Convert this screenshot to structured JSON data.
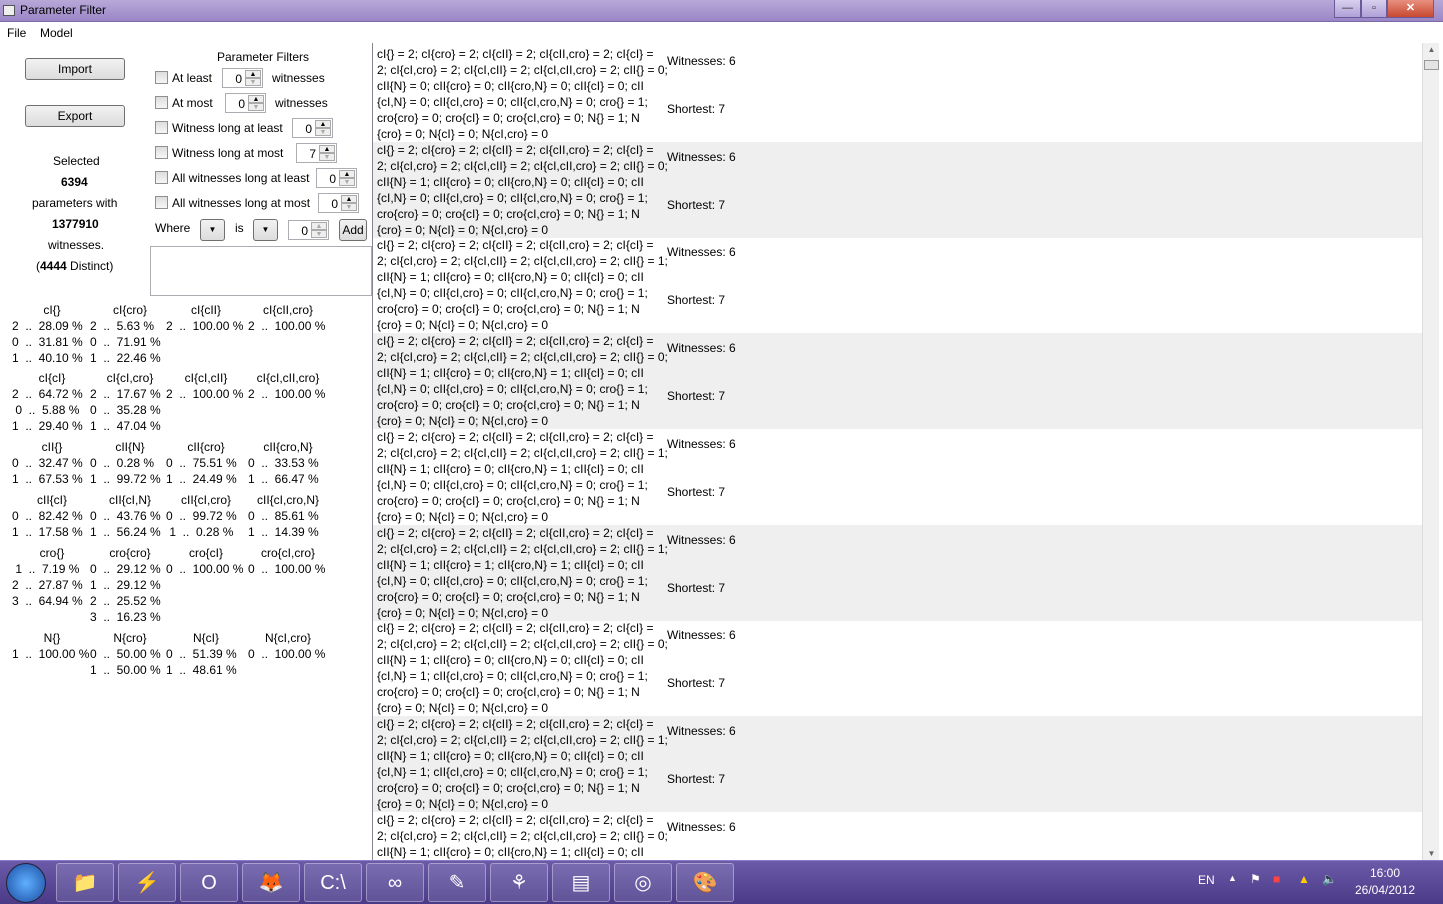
{
  "window": {
    "title": "Parameter Filter",
    "minimize": "—",
    "maximize": "▫",
    "close": "✕"
  },
  "menu": [
    "File",
    "Model"
  ],
  "actions": {
    "import": "Import",
    "export": "Export"
  },
  "summary": {
    "selected_label": "Selected",
    "selected_count": "6394",
    "params_with": "parameters with",
    "witness_count": "1377910",
    "witnesses_label": "witnesses.",
    "distinct_open": "(",
    "distinct_count": "4444",
    "distinct_close": " Distinct)"
  },
  "filters": {
    "title": "Parameter Filters",
    "rows": [
      {
        "label": "At least",
        "value": "0",
        "suffix": "witnesses",
        "checked": false
      },
      {
        "label": "At most",
        "value": "0",
        "suffix": "witnesses",
        "checked": false
      },
      {
        "label": "Witness long at least",
        "value": "0",
        "suffix": "",
        "checked": false
      },
      {
        "label": "Witness long at most",
        "value": "7",
        "suffix": "",
        "checked": false
      },
      {
        "label": "All witnesses long at least",
        "value": "0",
        "suffix": "",
        "checked": false
      },
      {
        "label": "All witnesses long at most",
        "value": "0",
        "suffix": "",
        "checked": false
      }
    ],
    "where_label": "Where",
    "is_label": "is",
    "where_value": "0",
    "add": "Add"
  },
  "stats": [
    [
      {
        "h": "cI{}",
        "r": [
          "2  ..  28.09 %",
          "0  ..  31.81 %",
          "1  ..  40.10 %"
        ]
      },
      {
        "h": "cI{cro}",
        "r": [
          "2  ..  5.63 %",
          "0  ..  71.91 %",
          "1  ..  22.46 %"
        ]
      },
      {
        "h": "cI{cII}",
        "r": [
          "2  ..  100.00 %"
        ]
      },
      {
        "h": "cI{cII,cro}",
        "r": [
          "2  ..  100.00 %"
        ]
      }
    ],
    [
      {
        "h": "cI{cI}",
        "r": [
          "2  ..  64.72 %",
          " 0  ..  5.88 %",
          "1  ..  29.40 %"
        ]
      },
      {
        "h": "cI{cI,cro}",
        "r": [
          "2  ..  17.67 %",
          "0  ..  35.28 %",
          "1  ..  47.04 %"
        ]
      },
      {
        "h": "cI{cI,cII}",
        "r": [
          "2  ..  100.00 %"
        ]
      },
      {
        "h": "cI{cI,cII,cro}",
        "r": [
          "2  ..  100.00 %"
        ]
      }
    ],
    [
      {
        "h": "cII{}",
        "r": [
          "0  ..  32.47 %",
          "1  ..  67.53 %"
        ]
      },
      {
        "h": "cII{N}",
        "r": [
          "0  ..  0.28 %",
          "1  ..  99.72 %"
        ]
      },
      {
        "h": "cII{cro}",
        "r": [
          "0  ..  75.51 %",
          "1  ..  24.49 %"
        ]
      },
      {
        "h": "cII{cro,N}",
        "r": [
          "0  ..  33.53 %",
          "1  ..  66.47 %"
        ]
      }
    ],
    [
      {
        "h": "cII{cI}",
        "r": [
          "0  ..  82.42 %",
          "1  ..  17.58 %"
        ]
      },
      {
        "h": "cII{cI,N}",
        "r": [
          "0  ..  43.76 %",
          "1  ..  56.24 %"
        ]
      },
      {
        "h": "cII{cI,cro}",
        "r": [
          "0  ..  99.72 %",
          " 1  ..  0.28 %"
        ]
      },
      {
        "h": "cII{cI,cro,N}",
        "r": [
          "0  ..  85.61 %",
          "1  ..  14.39 %"
        ]
      }
    ],
    [
      {
        "h": "cro{}",
        "r": [
          " 1  ..  7.19 %",
          "2  ..  27.87 %",
          "3  ..  64.94 %"
        ]
      },
      {
        "h": "cro{cro}",
        "r": [
          "0  ..  29.12 %",
          "1  ..  29.12 %",
          "2  ..  25.52 %",
          "3  ..  16.23 %"
        ]
      },
      {
        "h": "cro{cI}",
        "r": [
          "0  ..  100.00 %"
        ]
      },
      {
        "h": "cro{cI,cro}",
        "r": [
          "0  ..  100.00 %"
        ]
      }
    ],
    [
      {
        "h": "N{}",
        "r": [
          "1  ..  100.00 %"
        ]
      },
      {
        "h": "N{cro}",
        "r": [
          "0  ..  50.00 %",
          "1  ..  50.00 %"
        ]
      },
      {
        "h": "N{cI}",
        "r": [
          "0  ..  51.39 %",
          "1  ..  48.61 %"
        ]
      },
      {
        "h": "N{cI,cro}",
        "r": [
          "0  ..  100.00 %"
        ]
      }
    ]
  ],
  "records": [
    {
      "witnesses": "Witnesses: 6",
      "shortest": "Shortest: 7",
      "lines": [
        "cI{} = 2; cI{cro} = 2; cI{cII} = 2; cI{cII,cro} = 2; cI{cI} =",
        "2; cI{cI,cro} = 2; cI{cI,cII} = 2; cI{cI,cII,cro} = 2; cII{} = 0;",
        "cII{N} = 0; cII{cro} = 0; cII{cro,N} = 0; cII{cI} = 0; cII",
        "{cI,N} = 0; cII{cI,cro} = 0; cII{cI,cro,N} = 0; cro{} = 1;",
        "cro{cro} = 0; cro{cI} = 0; cro{cI,cro} = 0; N{} = 1; N",
        "{cro} = 0; N{cI} = 0; N{cI,cro} = 0"
      ]
    },
    {
      "witnesses": "Witnesses: 6",
      "shortest": "Shortest: 7",
      "lines": [
        "cI{} = 2; cI{cro} = 2; cI{cII} = 2; cI{cII,cro} = 2; cI{cI} =",
        "2; cI{cI,cro} = 2; cI{cI,cII} = 2; cI{cI,cII,cro} = 2; cII{} = 0;",
        "cII{N} = 1; cII{cro} = 0; cII{cro,N} = 0; cII{cI} = 0; cII",
        "{cI,N} = 0; cII{cI,cro} = 0; cII{cI,cro,N} = 0; cro{} = 1;",
        "cro{cro} = 0; cro{cI} = 0; cro{cI,cro} = 0; N{} = 1; N",
        "{cro} = 0; N{cI} = 0; N{cI,cro} = 0"
      ]
    },
    {
      "witnesses": "Witnesses: 6",
      "shortest": "Shortest: 7",
      "lines": [
        "cI{} = 2; cI{cro} = 2; cI{cII} = 2; cI{cII,cro} = 2; cI{cI} =",
        "2; cI{cI,cro} = 2; cI{cI,cII} = 2; cI{cI,cII,cro} = 2; cII{} = 1;",
        "cII{N} = 1; cII{cro} = 0; cII{cro,N} = 0; cII{cI} = 0; cII",
        "{cI,N} = 0; cII{cI,cro} = 0; cII{cI,cro,N} = 0; cro{} = 1;",
        "cro{cro} = 0; cro{cI} = 0; cro{cI,cro} = 0; N{} = 1; N",
        "{cro} = 0; N{cI} = 0; N{cI,cro} = 0"
      ]
    },
    {
      "witnesses": "Witnesses: 6",
      "shortest": "Shortest: 7",
      "lines": [
        "cI{} = 2; cI{cro} = 2; cI{cII} = 2; cI{cII,cro} = 2; cI{cI} =",
        "2; cI{cI,cro} = 2; cI{cI,cII} = 2; cI{cI,cII,cro} = 2; cII{} = 0;",
        "cII{N} = 1; cII{cro} = 0; cII{cro,N} = 1; cII{cI} = 0; cII",
        "{cI,N} = 0; cII{cI,cro} = 0; cII{cI,cro,N} = 0; cro{} = 1;",
        "cro{cro} = 0; cro{cI} = 0; cro{cI,cro} = 0; N{} = 1; N",
        "{cro} = 0; N{cI} = 0; N{cI,cro} = 0"
      ]
    },
    {
      "witnesses": "Witnesses: 6",
      "shortest": "Shortest: 7",
      "lines": [
        "cI{} = 2; cI{cro} = 2; cI{cII} = 2; cI{cII,cro} = 2; cI{cI} =",
        "2; cI{cI,cro} = 2; cI{cI,cII} = 2; cI{cI,cII,cro} = 2; cII{} = 1;",
        "cII{N} = 1; cII{cro} = 0; cII{cro,N} = 1; cII{cI} = 0; cII",
        "{cI,N} = 0; cII{cI,cro} = 0; cII{cI,cro,N} = 0; cro{} = 1;",
        "cro{cro} = 0; cro{cI} = 0; cro{cI,cro} = 0; N{} = 1; N",
        "{cro} = 0; N{cI} = 0; N{cI,cro} = 0"
      ]
    },
    {
      "witnesses": "Witnesses: 6",
      "shortest": "Shortest: 7",
      "lines": [
        "cI{} = 2; cI{cro} = 2; cI{cII} = 2; cI{cII,cro} = 2; cI{cI} =",
        "2; cI{cI,cro} = 2; cI{cI,cII} = 2; cI{cI,cII,cro} = 2; cII{} = 1;",
        "cII{N} = 1; cII{cro} = 1; cII{cro,N} = 1; cII{cI} = 0; cII",
        "{cI,N} = 0; cII{cI,cro} = 0; cII{cI,cro,N} = 0; cro{} = 1;",
        "cro{cro} = 0; cro{cI} = 0; cro{cI,cro} = 0; N{} = 1; N",
        "{cro} = 0; N{cI} = 0; N{cI,cro} = 0"
      ]
    },
    {
      "witnesses": "Witnesses: 6",
      "shortest": "Shortest: 7",
      "lines": [
        "cI{} = 2; cI{cro} = 2; cI{cII} = 2; cI{cII,cro} = 2; cI{cI} =",
        "2; cI{cI,cro} = 2; cI{cI,cII} = 2; cI{cI,cII,cro} = 2; cII{} = 0;",
        "cII{N} = 1; cII{cro} = 0; cII{cro,N} = 0; cII{cI} = 0; cII",
        "{cI,N} = 1; cII{cI,cro} = 0; cII{cI,cro,N} = 0; cro{} = 1;",
        "cro{cro} = 0; cro{cI} = 0; cro{cI,cro} = 0; N{} = 1; N",
        "{cro} = 0; N{cI} = 0; N{cI,cro} = 0"
      ]
    },
    {
      "witnesses": "Witnesses: 6",
      "shortest": "Shortest: 7",
      "lines": [
        "cI{} = 2; cI{cro} = 2; cI{cII} = 2; cI{cII,cro} = 2; cI{cI} =",
        "2; cI{cI,cro} = 2; cI{cI,cII} = 2; cI{cI,cII,cro} = 2; cII{} = 1;",
        "cII{N} = 1; cII{cro} = 0; cII{cro,N} = 0; cII{cI} = 0; cII",
        "{cI,N} = 1; cII{cI,cro} = 0; cII{cI,cro,N} = 0; cro{} = 1;",
        "cro{cro} = 0; cro{cI} = 0; cro{cI,cro} = 0; N{} = 1; N",
        "{cro} = 0; N{cI} = 0; N{cI,cro} = 0"
      ]
    },
    {
      "witnesses": "Witnesses: 6",
      "shortest": "",
      "lines": [
        "cI{} = 2; cI{cro} = 2; cI{cII} = 2; cI{cII,cro} = 2; cI{cI} =",
        "2; cI{cI,cro} = 2; cI{cI,cII} = 2; cI{cI,cII,cro} = 2; cII{} = 0;",
        "cII{N} = 1; cII{cro} = 0; cII{cro,N} = 1; cII{cI} = 0; cII"
      ]
    }
  ],
  "taskbar": {
    "apps": [
      "explorer-icon",
      "sketch-icon",
      "opera-icon",
      "firefox-icon",
      "terminal-icon",
      "infinity-icon",
      "notepad-icon",
      "tool-icon",
      "window-icon",
      "media-icon",
      "paint-icon"
    ],
    "glyphs": [
      "📁",
      "⚡",
      "O",
      "🦊",
      "C:\\",
      "∞",
      "✎",
      "⚘",
      "▤",
      "◎",
      "🎨"
    ],
    "lang": "EN",
    "time": "16:00",
    "date": "26/04/2012"
  }
}
